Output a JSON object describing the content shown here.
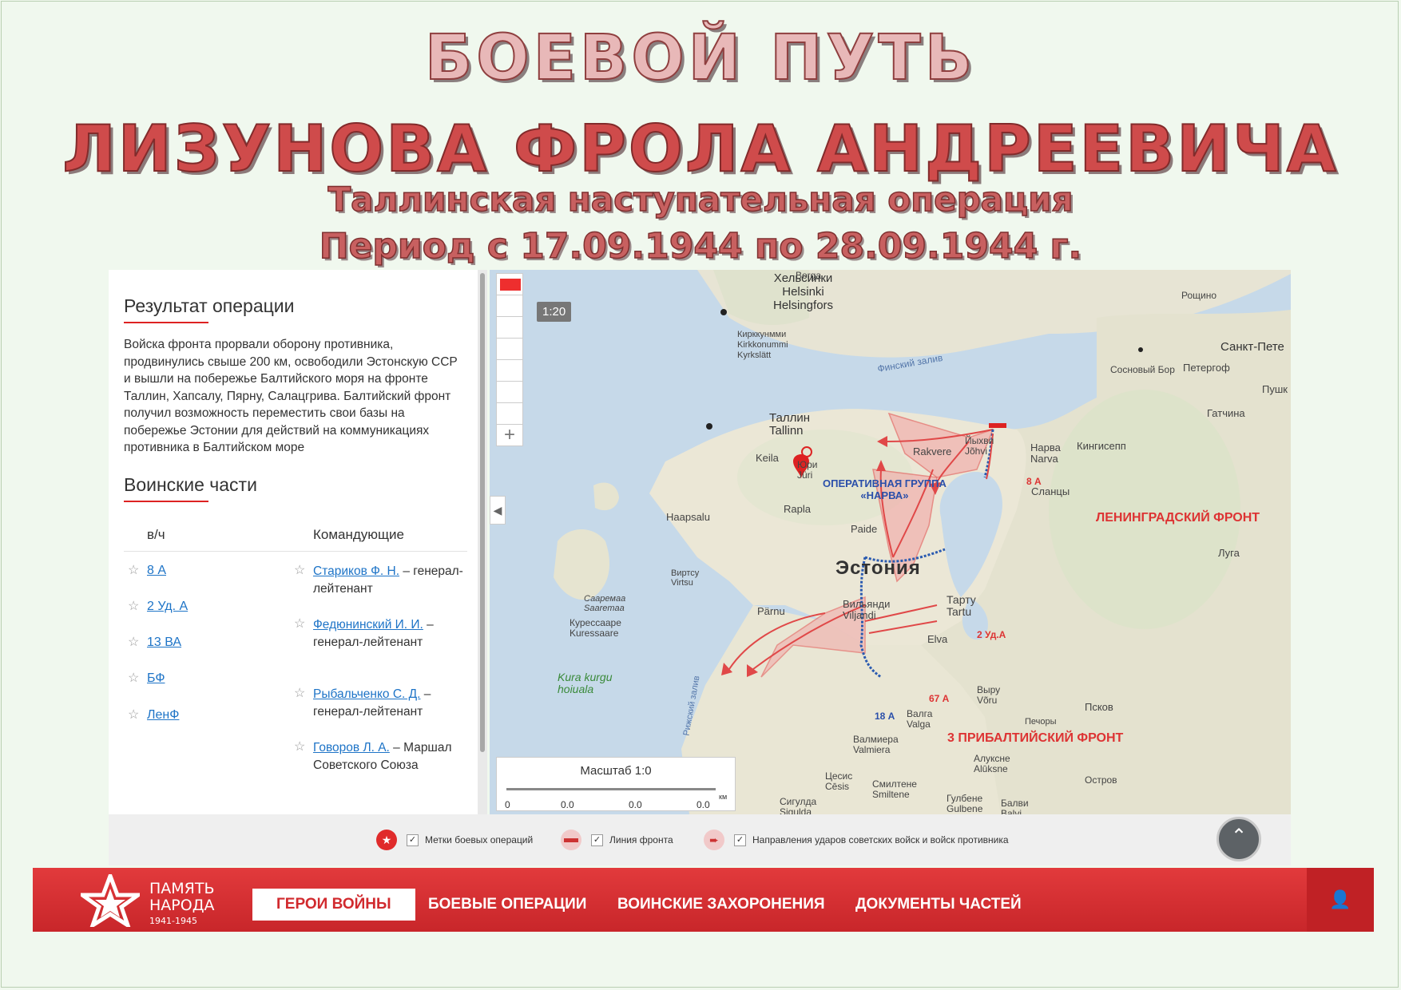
{
  "title": {
    "line1": "БОЕВОЙ ПУТЬ",
    "line2": "ЛИЗУНОВА ФРОЛА АНДРЕЕВИЧА",
    "line3": "Таллинская наступательная операция",
    "line4": "Период с 17.09.1944 по 28.09.1944 г."
  },
  "panel": {
    "result_heading": "Результат операции",
    "result_text": "Войска фронта прорвали оборону противника, продвинулись свыше 200 км, освободили Эстонскую ССР и вышли на побережье Балтийского моря на фронте Таллин, Хапсалу, Пярну, Салацгрива. Балтийский фронт получил возможность переместить свои базы на побережье Эстонии для действий на коммуникациях противника в Балтийском море",
    "units_heading": "Воинские части",
    "col_unit": "в/ч",
    "col_commanders": "Командующие",
    "units": [
      "8 А",
      "2 Уд. А",
      "13 ВА",
      "БФ",
      "ЛенФ"
    ],
    "commanders": [
      {
        "name": "Стариков Ф. Н.",
        "rank": " – генерал-лейтенант"
      },
      {
        "name": "Федюнинский И. И.",
        "rank": " – генерал-лейтенант"
      },
      {
        "name": "Рыбальченко С. Д.",
        "rank": " – генерал-лейтенант"
      },
      {
        "name": "Говоров Л. А.",
        "rank": " – Маршал Советского Союза"
      }
    ]
  },
  "map": {
    "zoom_label": "1:20",
    "scale_label": "Масштаб 1:0",
    "scale_ticks": [
      "0",
      "0.0",
      "0.0",
      "0.0",
      "км"
    ],
    "labels": {
      "helsinki": "Хельсинки\nHelsinki\nHelsingfors",
      "kirkkonummi": "Кирккунмми\nKirkkonummi\nKyrkslätt",
      "gulf": "Финский залив",
      "tallinn": "Таллин\nTallinn",
      "keila": "Keila",
      "yuri": "Юри\nJüri",
      "rakvere": "Rakvere",
      "johvi": "Йыхви\nJõhvi",
      "narva": "Нарва\nNarva",
      "kingisepp": "Кингисепп",
      "slantsy": "Сланцы",
      "haapsalu": "Haapsalu",
      "rapla": "Rapla",
      "paide": "Paide",
      "estonia": "Эстония",
      "virtsu": "Виртсу\nVirtsu",
      "saaremaa": "Сааремаа\nSaaremaa",
      "kuressaare": "Курессааре\nKuressaare",
      "kura": "Kura kurgu\nhoiuala",
      "parnu": "Pärnu",
      "viljandi": "Вильянди\nViljandi",
      "tartu": "Тарту\nTartu",
      "elva": "Elva",
      "voru": "Выру\nVõru",
      "valga": "Валга\nValga",
      "valmiera": "Валмиера\nValmiera",
      "cesis": "Цесис\nCēsis",
      "smiltene": "Смилтене\nSmiltene",
      "aluksne": "Алуксне\nAlūksne",
      "gulbene": "Гулбене\nGulbene",
      "sigulda": "Сигулда\nSigulda",
      "balvi": "Балви\nBalvi",
      "pskov": "Псков",
      "pechory": "Печоры",
      "ostrov": "Остров",
      "luga": "Луга",
      "gatchina": "Гатчина",
      "pushkin": "Пушк",
      "peterhof": "Петергоф",
      "sosnovy": "Сосновый Бор",
      "spb": "Санкт-Пете",
      "roshchino": "Рощино",
      "borga": "Borga",
      "riga_gulf": "Рижский залив"
    },
    "annotations": {
      "op_group": "ОПЕРАТИВНАЯ ГРУППА\n«НАРВА»",
      "lenfront": "ЛЕНИНГРАДСКИЙ ФРОНТ",
      "baltfront3": "3 ПРИБАЛТИЙСКИЙ ФРОНТ",
      "a8": "8 А",
      "a2ud": "2 Уд.А",
      "a67": "67 А",
      "a18": "18 А"
    }
  },
  "legend": [
    {
      "label": "Метки боевых операций",
      "icon": "star-marker-icon"
    },
    {
      "label": "Линия фронта",
      "icon": "front-line-icon"
    },
    {
      "label": "Направления ударов советских войск и войск противника",
      "icon": "attack-arrow-icon"
    }
  ],
  "nav": {
    "logo_line1": "ПАМЯТЬ",
    "logo_line2": "НАРОДА",
    "logo_years": "1941-1945",
    "items": [
      "ГЕРОИ ВОЙНЫ",
      "БОЕВЫЕ ОПЕРАЦИИ",
      "ВОИНСКИЕ ЗАХОРОНЕНИЯ",
      "ДОКУМЕНТЫ ЧАСТЕЙ"
    ]
  },
  "colors": {
    "accent": "#d12a2e",
    "link": "#1e74c7",
    "land": "#e7e4d4",
    "sea": "#c6d9e9"
  }
}
